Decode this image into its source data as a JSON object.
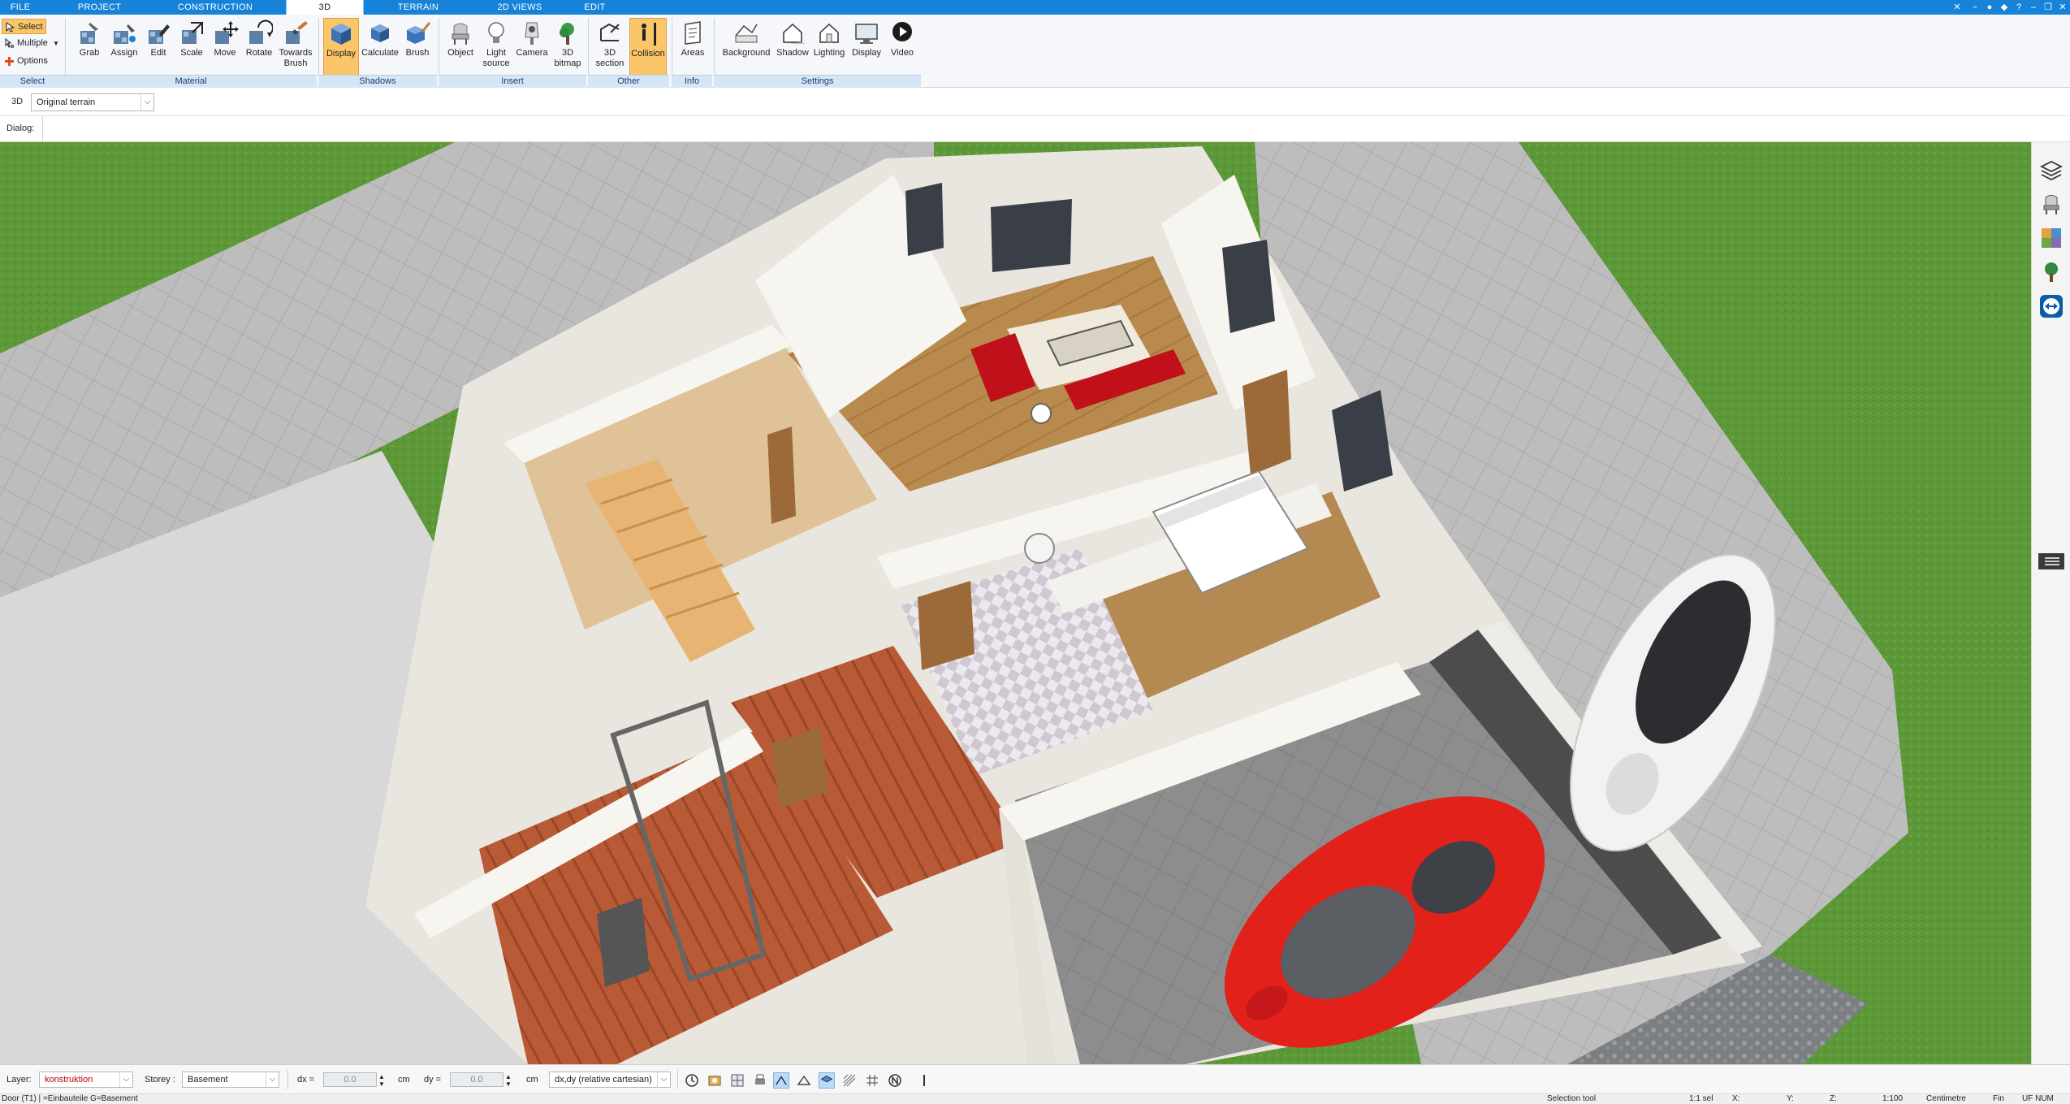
{
  "tabs": [
    "FILE",
    "PROJECT",
    "CONSTRUCTION",
    "3D",
    "TERRAIN",
    "2D VIEWS",
    "EDIT"
  ],
  "active_tab": "3D",
  "select_group": {
    "select": "Select",
    "multiple": "Multiple",
    "options": "Options",
    "label": "Select"
  },
  "material_group": {
    "label": "Material",
    "buttons": [
      "Grab",
      "Assign",
      "Edit",
      "Scale",
      "Move",
      "Rotate",
      "Towards",
      "Brush"
    ],
    "towards_brush": [
      "Towards",
      "Brush"
    ]
  },
  "shadows_group": {
    "label": "Shadows",
    "buttons": [
      "Display",
      "Calculate",
      "Brush"
    ]
  },
  "insert_group": {
    "label": "Insert",
    "buttons": [
      "Object",
      "Light",
      "Camera",
      "3D"
    ],
    "light_second": "source",
    "bitmap_second": "bitmap"
  },
  "other_group": {
    "label": "Other",
    "section": [
      "3D",
      "section"
    ],
    "collision": "Collision"
  },
  "info_group": {
    "label": "Info",
    "areas": "Areas"
  },
  "settings_group": {
    "label": "Settings",
    "buttons": [
      "Background",
      "Shadow",
      "Lighting",
      "Display",
      "Video"
    ]
  },
  "view_row": {
    "mode": "3D",
    "terrain": "Original terrain"
  },
  "dialog_label": "Dialog:",
  "status": {
    "layer_label": "Layer:",
    "layer_value": "konstruktion",
    "layer_color": "#c00000",
    "storey_label": "Storey :",
    "storey_value": "Basement",
    "dx_label": "dx =",
    "dx_value": "0.0",
    "dy_label": "dy =",
    "dy_value": "0.0",
    "unit": "cm",
    "coord_mode": "dx,dy (relative cartesian)"
  },
  "infobar": {
    "left": "Door (T1) | =Einbauteile G=Basement",
    "tool": "Selection tool",
    "sel": "1:1 sel",
    "x": "X:",
    "y": "Y:",
    "z": "Z:",
    "scale": "1:100",
    "units": "Centimetre",
    "fin": "Fin",
    "flags": "UF NUM"
  },
  "colors": {
    "accent": "#1683d8",
    "ribbon_active": "#fbc66a",
    "grass": "#5e9a3a",
    "paving": "#b9b9b9",
    "wall": "#f7f5f0",
    "wood_floor": "#b8854b",
    "red_car": "#e1211a"
  },
  "icons": [
    "select-icon",
    "multiple-icon",
    "options-icon",
    "grab-icon",
    "assign-icon",
    "edit-icon",
    "scale-icon",
    "move-icon",
    "rotate-icon",
    "towards-brush-icon",
    "display-icon",
    "calculate-icon",
    "brush-icon",
    "object-icon",
    "light-source-icon",
    "camera-icon",
    "3d-bitmap-icon",
    "3d-section-icon",
    "collision-icon",
    "areas-icon",
    "background-icon",
    "shadow-icon",
    "lighting-icon",
    "display-settings-icon",
    "video-icon",
    "layers-icon",
    "furniture-icon",
    "materials-icon",
    "tree-icon",
    "teamviewer-icon",
    "collapse-icon"
  ]
}
